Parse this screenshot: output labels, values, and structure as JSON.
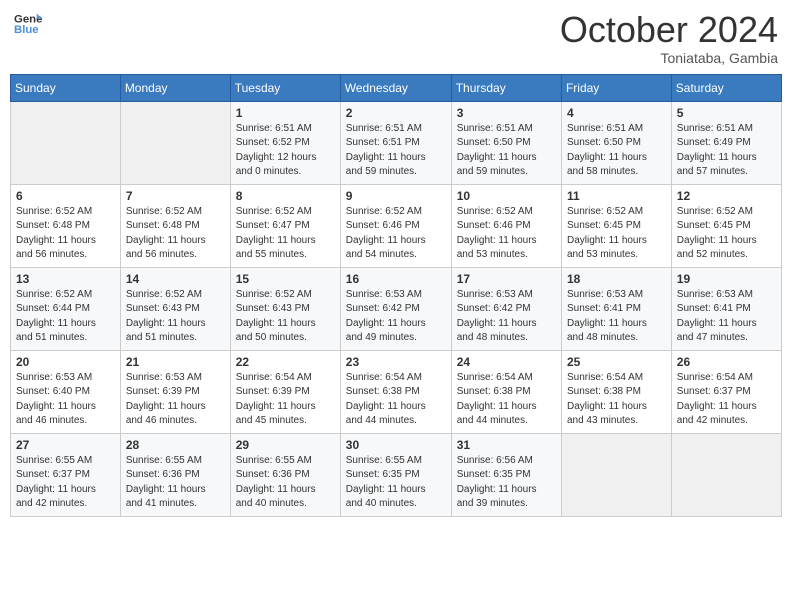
{
  "logo": {
    "line1": "General",
    "line2": "Blue"
  },
  "title": "October 2024",
  "subtitle": "Toniataba, Gambia",
  "days_of_week": [
    "Sunday",
    "Monday",
    "Tuesday",
    "Wednesday",
    "Thursday",
    "Friday",
    "Saturday"
  ],
  "weeks": [
    [
      {
        "day": "",
        "info": ""
      },
      {
        "day": "",
        "info": ""
      },
      {
        "day": "1",
        "info": "Sunrise: 6:51 AM\nSunset: 6:52 PM\nDaylight: 12 hours\nand 0 minutes."
      },
      {
        "day": "2",
        "info": "Sunrise: 6:51 AM\nSunset: 6:51 PM\nDaylight: 11 hours\nand 59 minutes."
      },
      {
        "day": "3",
        "info": "Sunrise: 6:51 AM\nSunset: 6:50 PM\nDaylight: 11 hours\nand 59 minutes."
      },
      {
        "day": "4",
        "info": "Sunrise: 6:51 AM\nSunset: 6:50 PM\nDaylight: 11 hours\nand 58 minutes."
      },
      {
        "day": "5",
        "info": "Sunrise: 6:51 AM\nSunset: 6:49 PM\nDaylight: 11 hours\nand 57 minutes."
      }
    ],
    [
      {
        "day": "6",
        "info": "Sunrise: 6:52 AM\nSunset: 6:48 PM\nDaylight: 11 hours\nand 56 minutes."
      },
      {
        "day": "7",
        "info": "Sunrise: 6:52 AM\nSunset: 6:48 PM\nDaylight: 11 hours\nand 56 minutes."
      },
      {
        "day": "8",
        "info": "Sunrise: 6:52 AM\nSunset: 6:47 PM\nDaylight: 11 hours\nand 55 minutes."
      },
      {
        "day": "9",
        "info": "Sunrise: 6:52 AM\nSunset: 6:46 PM\nDaylight: 11 hours\nand 54 minutes."
      },
      {
        "day": "10",
        "info": "Sunrise: 6:52 AM\nSunset: 6:46 PM\nDaylight: 11 hours\nand 53 minutes."
      },
      {
        "day": "11",
        "info": "Sunrise: 6:52 AM\nSunset: 6:45 PM\nDaylight: 11 hours\nand 53 minutes."
      },
      {
        "day": "12",
        "info": "Sunrise: 6:52 AM\nSunset: 6:45 PM\nDaylight: 11 hours\nand 52 minutes."
      }
    ],
    [
      {
        "day": "13",
        "info": "Sunrise: 6:52 AM\nSunset: 6:44 PM\nDaylight: 11 hours\nand 51 minutes."
      },
      {
        "day": "14",
        "info": "Sunrise: 6:52 AM\nSunset: 6:43 PM\nDaylight: 11 hours\nand 51 minutes."
      },
      {
        "day": "15",
        "info": "Sunrise: 6:52 AM\nSunset: 6:43 PM\nDaylight: 11 hours\nand 50 minutes."
      },
      {
        "day": "16",
        "info": "Sunrise: 6:53 AM\nSunset: 6:42 PM\nDaylight: 11 hours\nand 49 minutes."
      },
      {
        "day": "17",
        "info": "Sunrise: 6:53 AM\nSunset: 6:42 PM\nDaylight: 11 hours\nand 48 minutes."
      },
      {
        "day": "18",
        "info": "Sunrise: 6:53 AM\nSunset: 6:41 PM\nDaylight: 11 hours\nand 48 minutes."
      },
      {
        "day": "19",
        "info": "Sunrise: 6:53 AM\nSunset: 6:41 PM\nDaylight: 11 hours\nand 47 minutes."
      }
    ],
    [
      {
        "day": "20",
        "info": "Sunrise: 6:53 AM\nSunset: 6:40 PM\nDaylight: 11 hours\nand 46 minutes."
      },
      {
        "day": "21",
        "info": "Sunrise: 6:53 AM\nSunset: 6:39 PM\nDaylight: 11 hours\nand 46 minutes."
      },
      {
        "day": "22",
        "info": "Sunrise: 6:54 AM\nSunset: 6:39 PM\nDaylight: 11 hours\nand 45 minutes."
      },
      {
        "day": "23",
        "info": "Sunrise: 6:54 AM\nSunset: 6:38 PM\nDaylight: 11 hours\nand 44 minutes."
      },
      {
        "day": "24",
        "info": "Sunrise: 6:54 AM\nSunset: 6:38 PM\nDaylight: 11 hours\nand 44 minutes."
      },
      {
        "day": "25",
        "info": "Sunrise: 6:54 AM\nSunset: 6:38 PM\nDaylight: 11 hours\nand 43 minutes."
      },
      {
        "day": "26",
        "info": "Sunrise: 6:54 AM\nSunset: 6:37 PM\nDaylight: 11 hours\nand 42 minutes."
      }
    ],
    [
      {
        "day": "27",
        "info": "Sunrise: 6:55 AM\nSunset: 6:37 PM\nDaylight: 11 hours\nand 42 minutes."
      },
      {
        "day": "28",
        "info": "Sunrise: 6:55 AM\nSunset: 6:36 PM\nDaylight: 11 hours\nand 41 minutes."
      },
      {
        "day": "29",
        "info": "Sunrise: 6:55 AM\nSunset: 6:36 PM\nDaylight: 11 hours\nand 40 minutes."
      },
      {
        "day": "30",
        "info": "Sunrise: 6:55 AM\nSunset: 6:35 PM\nDaylight: 11 hours\nand 40 minutes."
      },
      {
        "day": "31",
        "info": "Sunrise: 6:56 AM\nSunset: 6:35 PM\nDaylight: 11 hours\nand 39 minutes."
      },
      {
        "day": "",
        "info": ""
      },
      {
        "day": "",
        "info": ""
      }
    ]
  ]
}
